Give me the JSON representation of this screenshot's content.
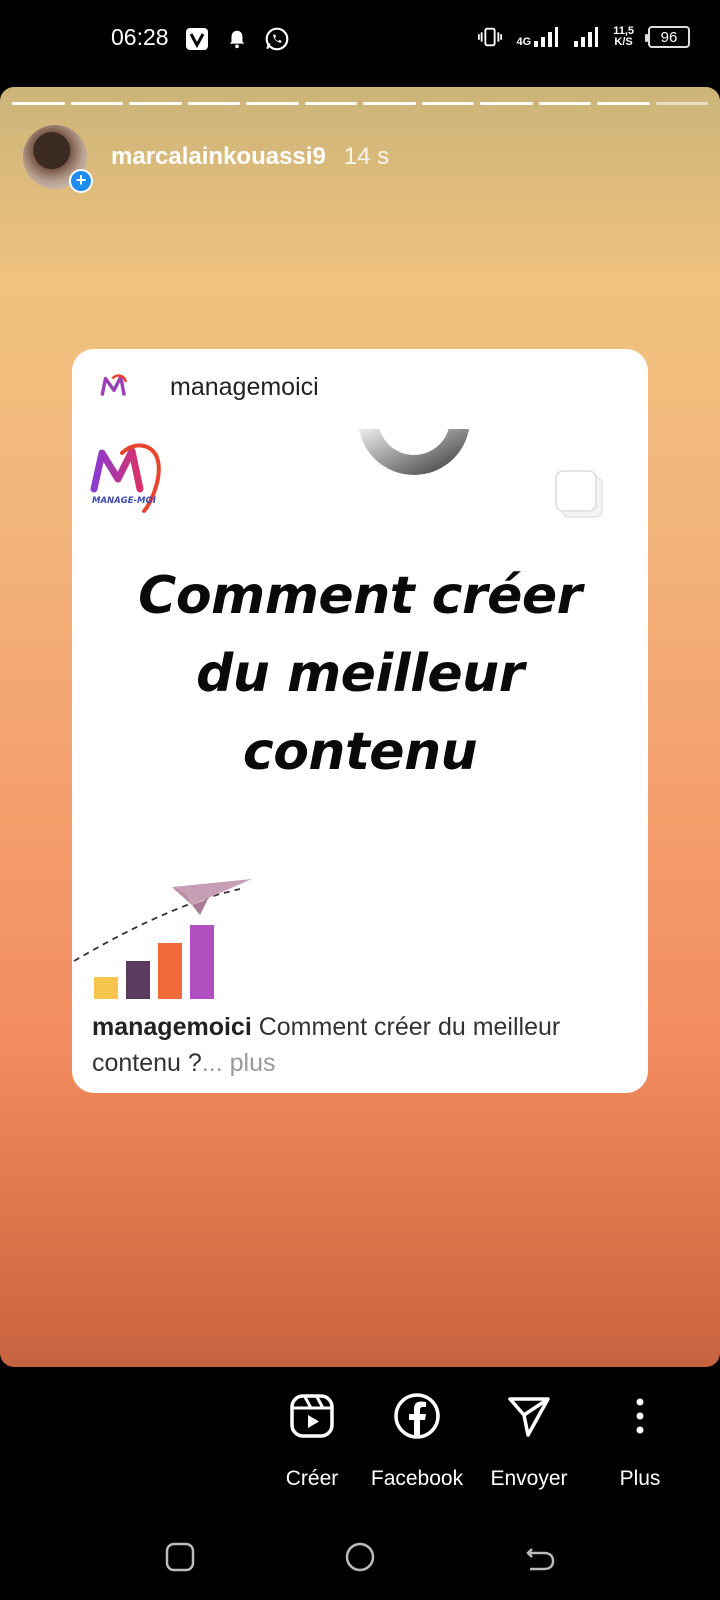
{
  "status_bar": {
    "time": "06:28",
    "network_4g": "4G",
    "speed_value": "11,5",
    "speed_unit": "K/S",
    "battery": "96",
    "icons": [
      "vpn-v-icon",
      "bell-icon",
      "whatsapp-icon",
      "vibrate-icon",
      "signal-icon",
      "signal-icon"
    ]
  },
  "story": {
    "progress_segments": 12,
    "username": "marcalainkouassi9",
    "timestamp": "14 s",
    "background_colors": [
      "#cbb479",
      "#f0c27e",
      "#f4a06c",
      "#c66340"
    ]
  },
  "post": {
    "account": "managemoici",
    "title_line1": "Comment créer",
    "title_line2": "du meilleur",
    "title_line3": "contenu",
    "logo_text": "MANAGE-MOI",
    "caption_user": "managemoici",
    "caption_text": " Comment créer du meilleur contenu ?",
    "caption_more": "... plus",
    "graphic_colors": [
      "#f4c64e",
      "#5b3a5e",
      "#f26a3a",
      "#b04fc0"
    ]
  },
  "actions": [
    {
      "label": "Créer",
      "icon": "reels-icon"
    },
    {
      "label": "Facebook",
      "icon": "facebook-icon"
    },
    {
      "label": "Envoyer",
      "icon": "send-icon"
    },
    {
      "label": "Plus",
      "icon": "more-vertical-icon"
    }
  ],
  "navbar": [
    "recent-apps-icon",
    "home-icon",
    "back-icon"
  ]
}
